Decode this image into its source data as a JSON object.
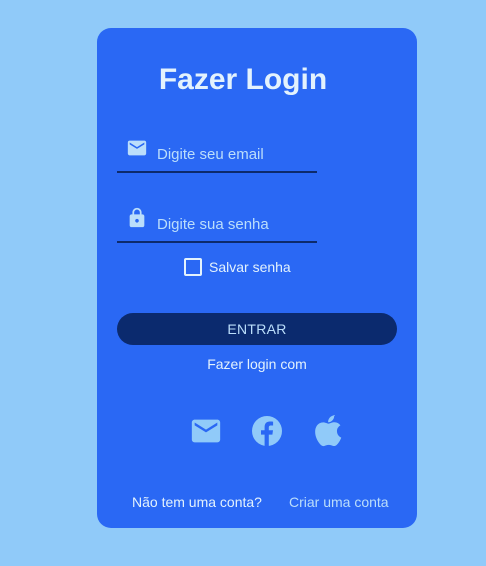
{
  "login": {
    "title": "Fazer Login",
    "email": {
      "icon": "email-icon",
      "placeholder": "Digite seu email",
      "value": ""
    },
    "password": {
      "icon": "lock-icon",
      "placeholder": "Digite sua senha",
      "value": ""
    },
    "remember": {
      "label": "Salvar senha",
      "checked": false
    },
    "submit_label": "ENTRAR",
    "social_label": "Fazer login com",
    "social_icons": [
      "email-icon",
      "facebook-icon",
      "apple-icon"
    ],
    "footer": {
      "no_account": "Não tem uma conta?",
      "create_account": "Criar uma conta"
    }
  },
  "colors": {
    "page_background": "#90caf9",
    "card_background": "#2a68f4",
    "button_background": "#0b2a6e",
    "text_light": "#e3f2fd",
    "text_muted": "#bbdefb",
    "icon_color": "#90caf9"
  }
}
